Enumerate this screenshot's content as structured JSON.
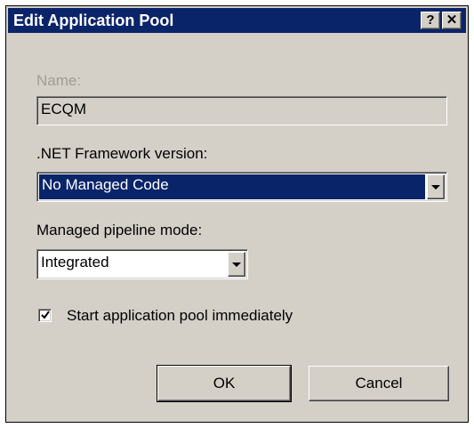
{
  "window": {
    "title": "Edit Application Pool",
    "help_label": "?",
    "close_label": "✕"
  },
  "name_field": {
    "label": "Name:",
    "value": "ECQM",
    "state": "disabled"
  },
  "framework": {
    "label": ".NET Framework version:",
    "selected": "No Managed Code"
  },
  "pipeline": {
    "label": "Managed pipeline mode:",
    "selected": "Integrated"
  },
  "start_immediately": {
    "label": "Start application pool immediately",
    "checked": true
  },
  "buttons": {
    "ok": "OK",
    "cancel": "Cancel"
  },
  "colors": {
    "titlebar": "#0a246a",
    "selection": "#0a246a",
    "dialog_bg": "#d4d0c8"
  },
  "icons": [
    "help-icon",
    "close-icon",
    "dropdown-arrow-icon",
    "checkmark-icon"
  ]
}
